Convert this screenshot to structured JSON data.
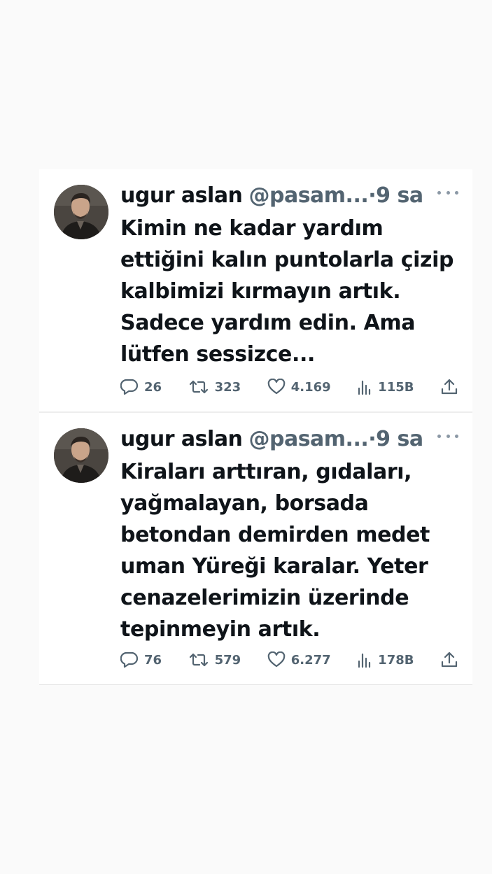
{
  "tweets": [
    {
      "name": "ugur aslan",
      "handle": "@pasam...",
      "separator": "·",
      "time": "9 sa",
      "text_lines": [
        "Kimin ne kadar yardım",
        "ettiğini kalın puntolarla çizip",
        "kalbimizi kırmayın artık.",
        "Sadece yardım edin. Ama",
        "lütfen sessizce..."
      ],
      "replies": "26",
      "retweets": "323",
      "likes": "4.169",
      "views": "115B"
    },
    {
      "name": "ugur aslan",
      "handle": "@pasam...",
      "separator": "·",
      "time": "9 sa",
      "text_lines": [
        "Kiraları arttıran, gıdaları,",
        "yağmalayan, borsada",
        "betondan demirden medet",
        "uman Yüreği karalar. Yeter",
        "cenazelerimizin üzerinde",
        "tepinmeyin artık."
      ],
      "replies": "76",
      "retweets": "579",
      "likes": "6.277",
      "views": "178B"
    }
  ],
  "icons": {
    "reply": "reply-icon",
    "retweet": "retweet-icon",
    "like": "heart-icon",
    "views": "views-icon",
    "share": "share-icon",
    "more": "more-icon"
  },
  "colors": {
    "text": "#0f1419",
    "secondary": "#536471",
    "background": "#fafafa"
  }
}
